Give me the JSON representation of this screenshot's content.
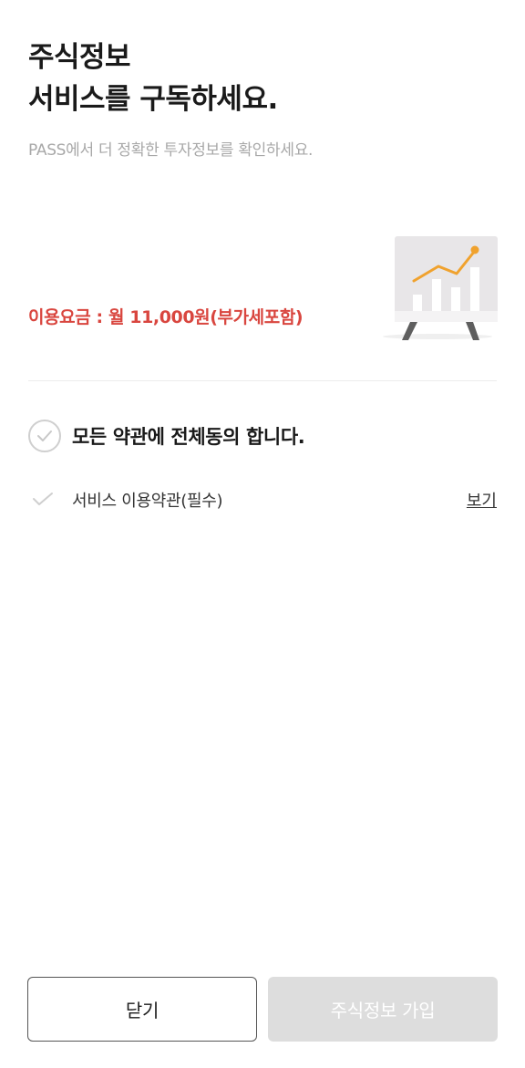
{
  "header": {
    "title_line1": "주식정보",
    "title_line2": "서비스를 구독하세요.",
    "subtitle": "PASS에서 더 정확한 투자정보를 확인하세요."
  },
  "pricing": {
    "text": "이용요금 : 월 11,000원(부가세포함)"
  },
  "illustration": {
    "icon": "stock-chart-board-icon"
  },
  "agreements": {
    "all_label": "모든 약관에 전체동의 합니다.",
    "all_checked": false,
    "items": [
      {
        "label": "서비스 이용약관(필수)",
        "view_label": "보기",
        "checked": false
      }
    ]
  },
  "footer": {
    "close_label": "닫기",
    "join_label": "주식정보 가입",
    "join_enabled": false
  },
  "colors": {
    "accent_price": "#d9463f",
    "chart_line": "#f0a22e",
    "disabled_button": "#dddddd"
  }
}
